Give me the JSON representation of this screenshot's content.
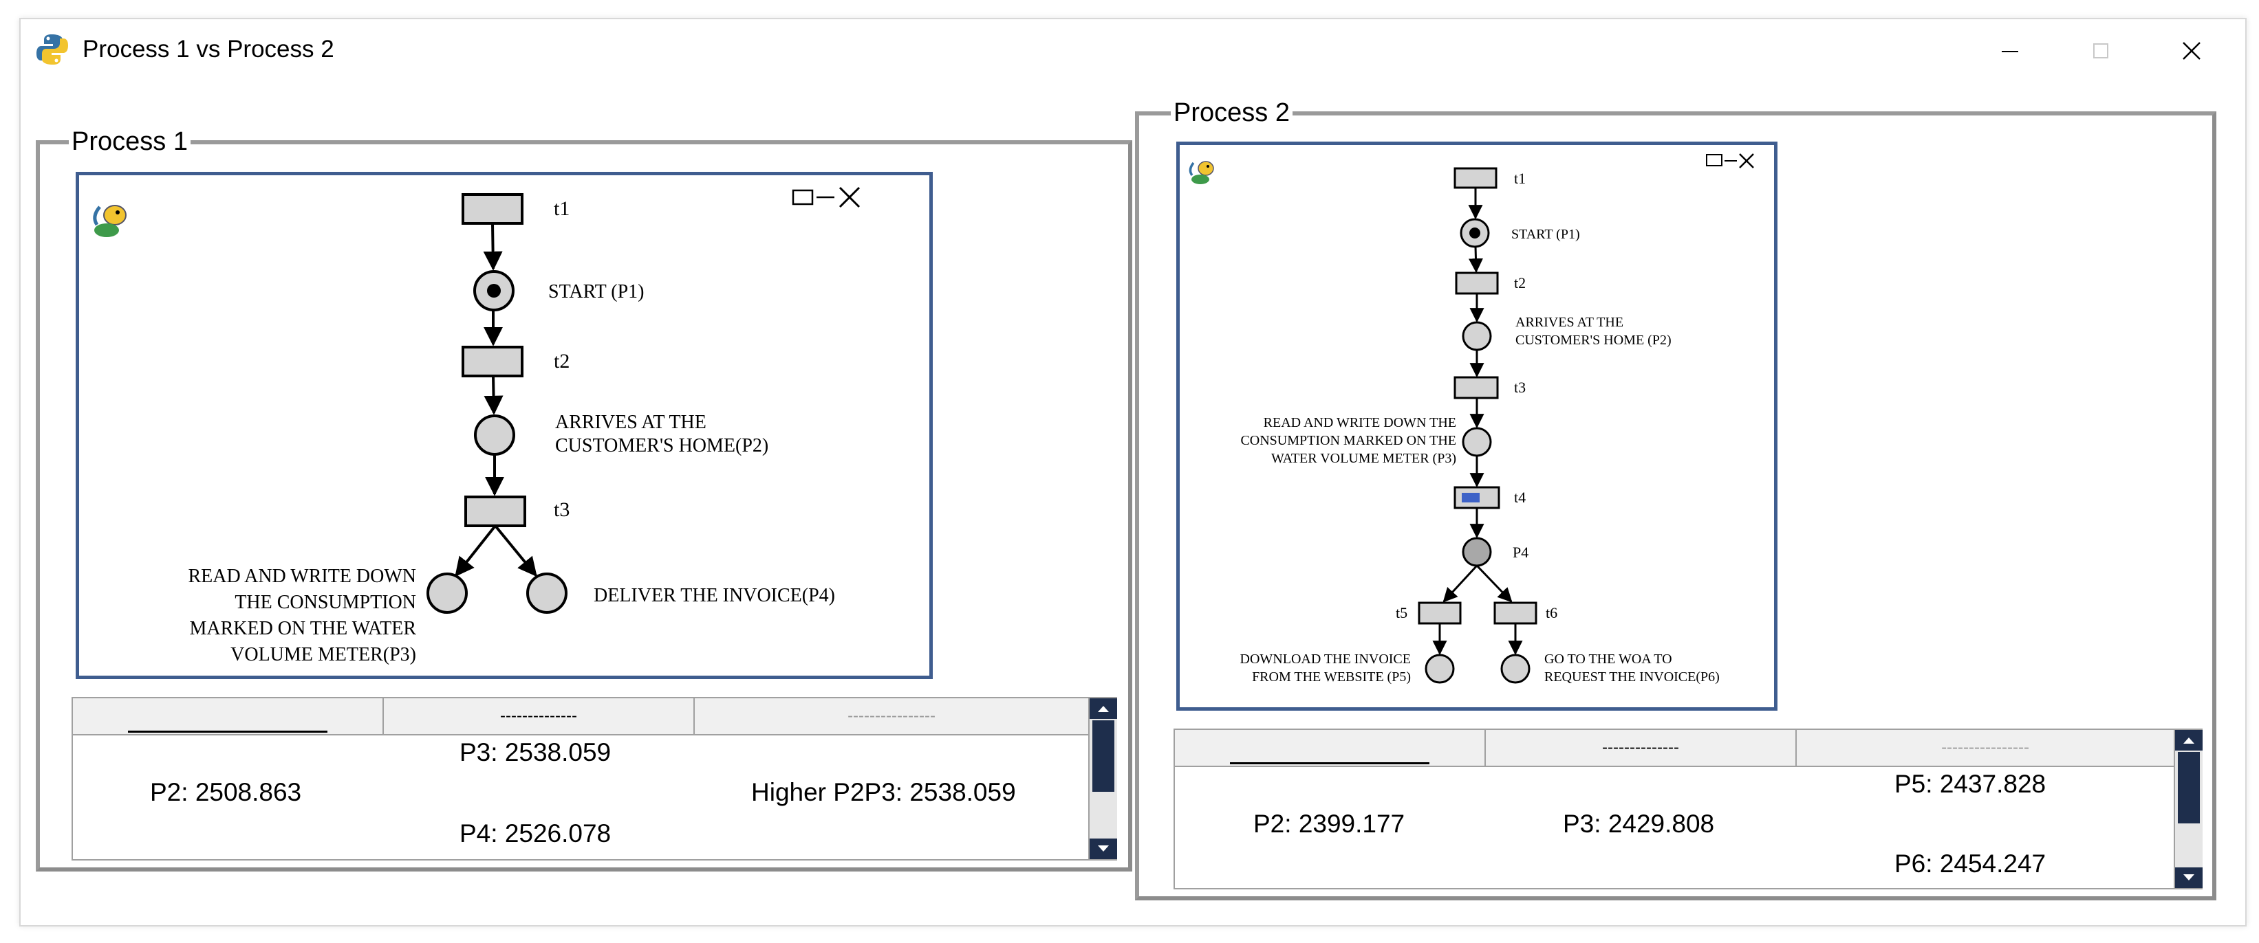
{
  "window": {
    "title": "Process 1 vs Process 2"
  },
  "process1": {
    "group_label": "Process 1",
    "diagram": {
      "t1": "t1",
      "t2": "t2",
      "t3": "t3",
      "p1": "START (P1)",
      "p2_lines": [
        "ARRIVES AT THE",
        "CUSTOMER'S HOME(P2)"
      ],
      "p3_lines": [
        "READ AND WRITE DOWN",
        "THE CONSUMPTION",
        "MARKED ON THE WATER",
        "VOLUME METER(P3)"
      ],
      "p4": "DELIVER THE INVOICE(P4)"
    },
    "table": {
      "headers": [
        "",
        "--------------",
        "----------------"
      ],
      "p3": "P3: 2538.059",
      "p2": "P2: 2508.863",
      "higher": "Higher P2P3: 2538.059",
      "p4": "P4: 2526.078"
    }
  },
  "process2": {
    "group_label": "Process 2",
    "diagram": {
      "t1": "t1",
      "t2": "t2",
      "t3": "t3",
      "t4": "t4",
      "t5": "t5",
      "t6": "t6",
      "p1": "START (P1)",
      "p2_lines": [
        "ARRIVES AT THE",
        "CUSTOMER'S HOME (P2)"
      ],
      "p3_lines": [
        "READ AND WRITE DOWN THE",
        "CONSUMPTION MARKED ON THE",
        "WATER VOLUME METER (P3)"
      ],
      "p4": "P4",
      "p5_lines": [
        "DOWNLOAD THE INVOICE",
        "FROM THE WEBSITE (P5)"
      ],
      "p6_lines": [
        "GO TO THE WOA TO",
        "REQUEST THE INVOICE(P6)"
      ]
    },
    "table": {
      "headers": [
        "",
        "--------------",
        "----------------"
      ],
      "p5": "P5: 2437.828",
      "p2": "P2: 2399.177",
      "p3": "P3: 2429.808",
      "p6": "P6: 2454.247"
    }
  },
  "colors": {
    "diagram_border": "#3f5d8f",
    "scrollbar": "#1e2e4c",
    "place_fill": "#d4d4d4",
    "transition_fill": "#d4d4d4"
  },
  "icons": {
    "app": "python-logo-icon",
    "diagram": "pygame-snake-icon"
  }
}
